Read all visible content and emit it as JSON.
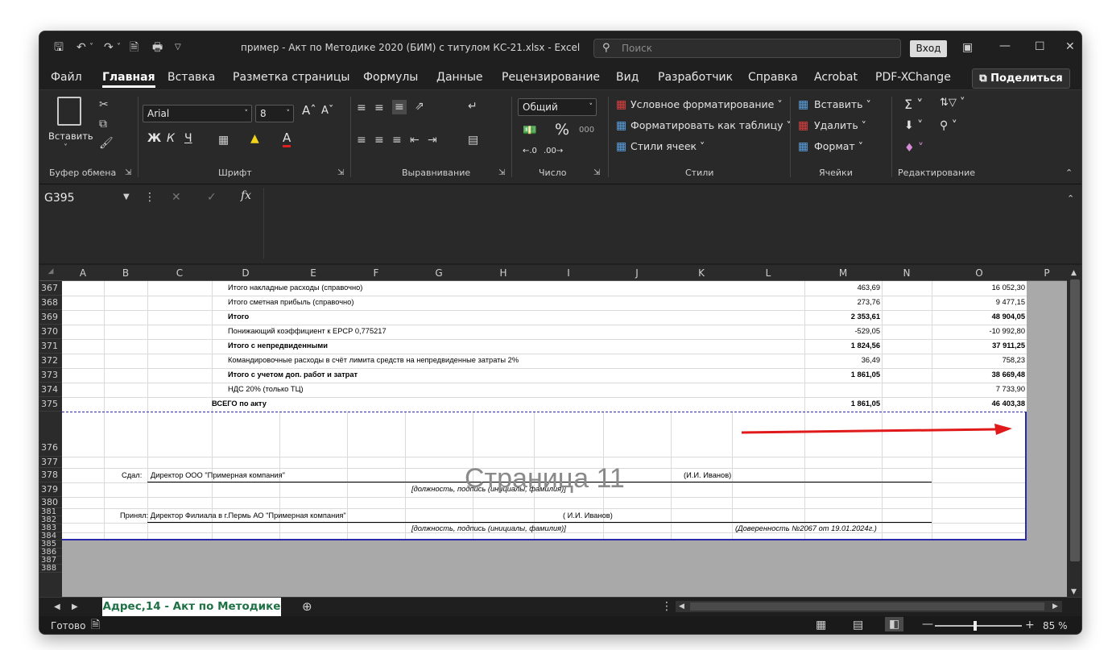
{
  "titlebar": {
    "title": "пример - Акт по Методике 2020 (БИМ) с титулом КС-21.xlsx  -  Excel",
    "search_placeholder": "Поиск",
    "signin": "Вход"
  },
  "menu": [
    "Файл",
    "Главная",
    "Вставка",
    "Разметка страницы",
    "Формулы",
    "Данные",
    "Рецензирование",
    "Вид",
    "Разработчик",
    "Справка",
    "Acrobat",
    "PDF-XChange"
  ],
  "share": "Поделиться",
  "ribbon": {
    "clipboard": {
      "paste": "Вставить",
      "group": "Буфер обмена"
    },
    "font": {
      "name": "Arial",
      "size": "8",
      "group": "Шрифт",
      "bold": "Ж",
      "italic": "К",
      "underline": "Ч"
    },
    "align": {
      "group": "Выравнивание"
    },
    "number": {
      "format": "Общий",
      "group": "Число"
    },
    "styles": {
      "cond": "Условное форматирование",
      "table": "Форматировать как таблицу",
      "cell": "Стили ячеек",
      "group": "Стили"
    },
    "cells": {
      "insert": "Вставить",
      "delete": "Удалить",
      "format": "Формат",
      "group": "Ячейки"
    },
    "editing": {
      "group": "Редактирование"
    }
  },
  "formula": {
    "namebox": "G395",
    "fx": "fx",
    "value": ""
  },
  "columns": [
    "A",
    "B",
    "C",
    "D",
    "E",
    "F",
    "G",
    "H",
    "I",
    "J",
    "K",
    "L",
    "M",
    "N",
    "O",
    "P"
  ],
  "rows": [
    {
      "n": "367",
      "label": "Итого накладные расходы (справочно)",
      "m": "463,69",
      "o": "16 052,30",
      "bold": false
    },
    {
      "n": "368",
      "label": "Итого сметная прибыль (справочно)",
      "m": "273,76",
      "o": "9 477,15",
      "bold": false
    },
    {
      "n": "369",
      "label": "Итого",
      "m": "2 353,61",
      "o": "48 904,05",
      "bold": true
    },
    {
      "n": "370",
      "label": "Понижающий коэффициент к ЕРСР 0,775217",
      "m": "-529,05",
      "o": "-10 992,80",
      "bold": false
    },
    {
      "n": "371",
      "label": "Итого с непредвиденными",
      "m": "1 824,56",
      "o": "37 911,25",
      "bold": true
    },
    {
      "n": "372",
      "label": "Командировочные расходы в счёт лимита средств на непредвиденные затраты 2%",
      "m": "36,49",
      "o": "758,23",
      "bold": false
    },
    {
      "n": "373",
      "label": "Итого с учетом доп. работ и затрат",
      "m": "1 861,05",
      "o": "38 669,48",
      "bold": true
    },
    {
      "n": "374",
      "label": "НДС 20% (только ТЦ)",
      "m": "",
      "o": "7 733,90",
      "bold": false
    },
    {
      "n": "375",
      "label": "ВСЕГО по акту",
      "m": "1 861,05",
      "o": "46 403,38",
      "bold": true
    }
  ],
  "lower_rows": [
    "376",
    "377",
    "378",
    "379",
    "380",
    "381",
    "382",
    "383",
    "384",
    "385",
    "386",
    "387",
    "388"
  ],
  "signatures": {
    "sdal_label": "Сдал:",
    "sdal_who": "Директор ООО \"Примерная компания\"",
    "sdal_name": "(И.И. Иванов)",
    "hint1": "[должность, подпись (инициалы, фамилия)]",
    "prinyal": "Принял: Директор Филиала в г.Пермь АО \"Примерная компания\"",
    "prinyal_name": "( И.И. Иванов)",
    "hint2": "[должность, подпись (инициалы, фамилия)]",
    "doverennost": "(Доверенность №2067 от 19.01.2024г.)"
  },
  "watermark": "Страница 11",
  "sheet_tab": "Адрес,14 - Акт по Методике",
  "status": {
    "ready": "Готово",
    "zoom": "85 %",
    "zoom_level": 85
  },
  "colors": {
    "accent_green": "#1e7145",
    "arrow": "#e01a1a",
    "page_border": "#2a2aa8"
  }
}
